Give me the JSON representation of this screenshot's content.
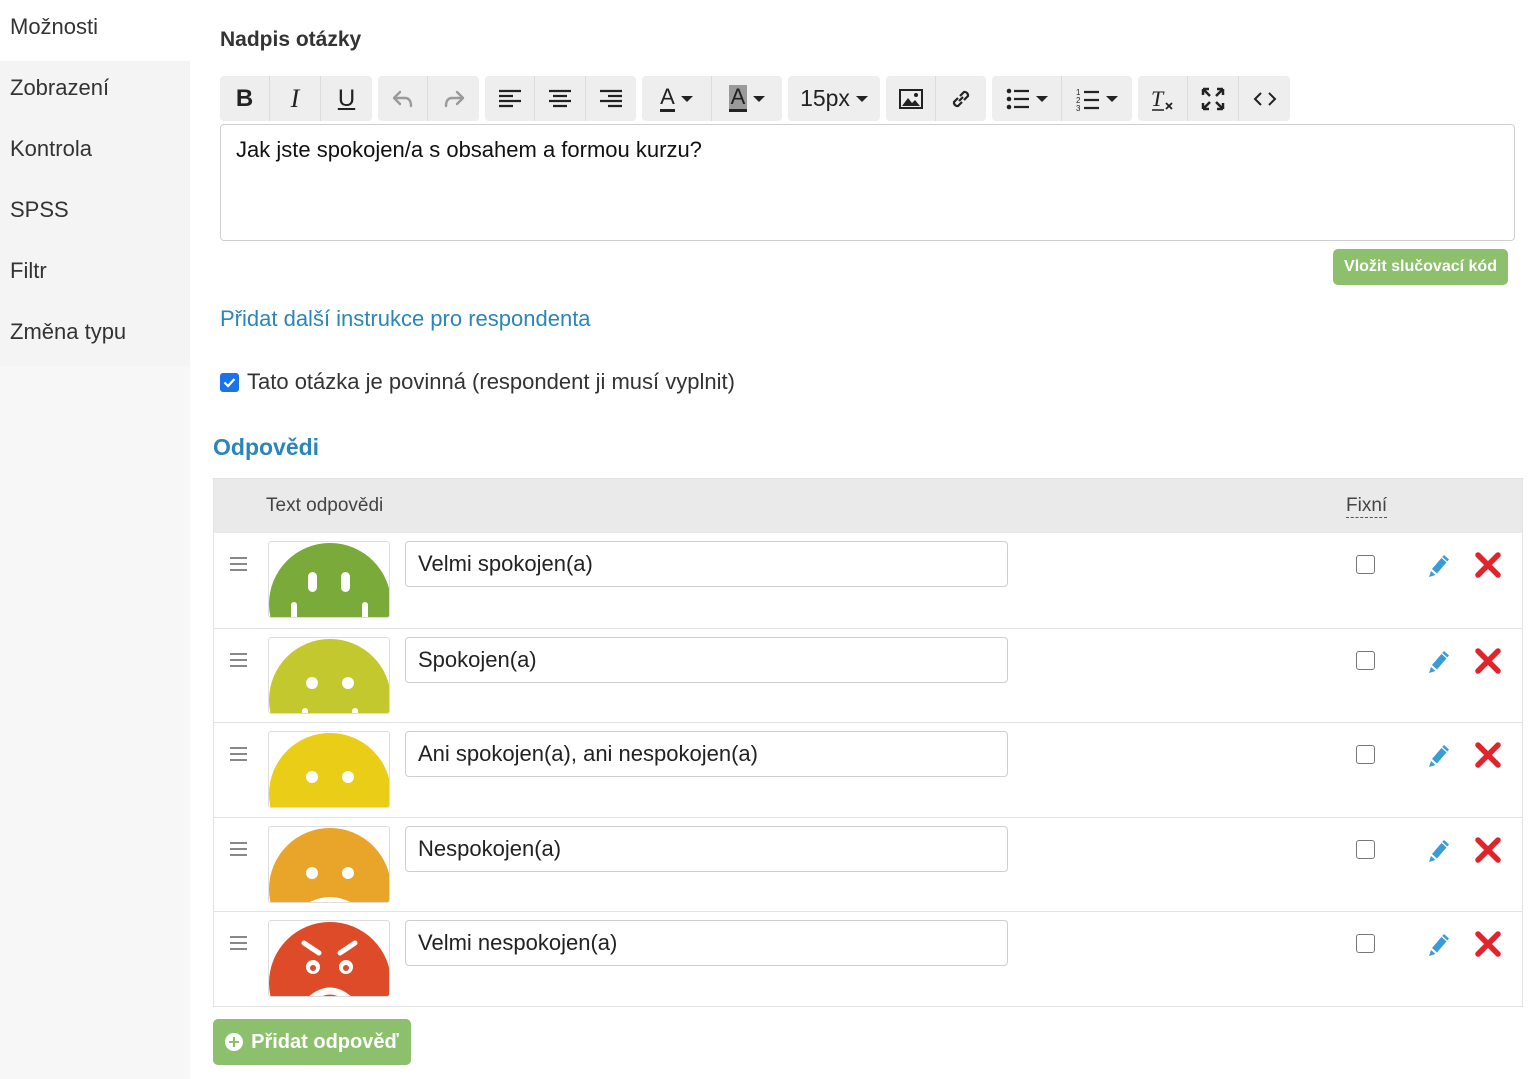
{
  "sidebar": {
    "items": [
      {
        "label": "Možnosti",
        "active": true
      },
      {
        "label": "Zobrazení",
        "active": false
      },
      {
        "label": "Kontrola",
        "active": false
      },
      {
        "label": "SPSS",
        "active": false
      },
      {
        "label": "Filtr",
        "active": false
      },
      {
        "label": "Změna typu",
        "active": false
      }
    ]
  },
  "question": {
    "title_label": "Nadpis otázky",
    "text": "Jak jste spokojen/a s obsahem a formou kurzu?"
  },
  "toolbar": {
    "font_size": "15px",
    "icons": [
      "bold-icon",
      "italic-icon",
      "underline-icon",
      "undo-icon",
      "redo-icon",
      "align-left-icon",
      "align-center-icon",
      "align-right-icon",
      "font-color-icon",
      "highlight-color-icon",
      "image-icon",
      "link-icon",
      "bullet-list-icon",
      "numbered-list-icon",
      "clear-format-icon",
      "fullscreen-icon",
      "code-view-icon"
    ],
    "bold": "B",
    "italic": "I",
    "underline": "U",
    "font_color": "A",
    "highlight_color": "A"
  },
  "merge_code_button": "Vložit slučovací kód",
  "add_instruction_link": "Přidat další instrukce pro respondenta",
  "required": {
    "label": "Tato otázka je povinná (respondent ji musí vyplnit)",
    "checked": true
  },
  "answers": {
    "title": "Odpovědi",
    "col_text": "Text odpovědi",
    "col_fixed": "Fixní",
    "rows": [
      {
        "text": "Velmi spokojen(a)",
        "color": "#7aaa3a",
        "fixed": false
      },
      {
        "text": "Spokojen(a)",
        "color": "#c4c82f",
        "fixed": false
      },
      {
        "text": "Ani spokojen(a), ani nespokojen(a)",
        "color": "#e9cd17",
        "fixed": false
      },
      {
        "text": "Nespokojen(a)",
        "color": "#e9a52a",
        "fixed": false
      },
      {
        "text": "Velmi nespokojen(a)",
        "color": "#de4b28",
        "fixed": false
      }
    ],
    "add_button": "Přidat odpověď"
  },
  "colors": {
    "accent_blue": "#2a86b8",
    "button_green": "#8cc06c",
    "delete_red": "#e0242c",
    "edit_blue": "#3a9bd5"
  }
}
